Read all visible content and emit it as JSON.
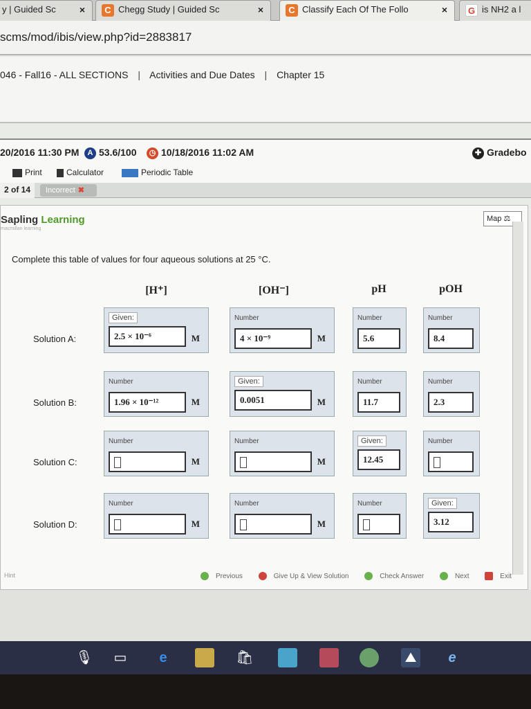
{
  "tabs": [
    {
      "label": "y | Guided Sc",
      "close": "×",
      "icon": "none"
    },
    {
      "label": "Chegg Study | Guided Sc",
      "close": "×",
      "icon": "C"
    },
    {
      "label": "Classify Each Of The Follo",
      "close": "×",
      "icon": "C"
    },
    {
      "label": "is NH2 a l",
      "close": "",
      "icon": "G"
    }
  ],
  "colors": {
    "chegg": "#e8772e",
    "google": "#d44638",
    "sapling_green": "#4f9a2a"
  },
  "url": "scms/mod/ibis/view.php?id=2883817",
  "breadcrumbs": {
    "course": "046 - Fall16 - ALL SECTIONS",
    "sep1": "|",
    "activities": "Activities and Due Dates",
    "sep2": "|",
    "chapter": "Chapter 15"
  },
  "status": {
    "due": "20/2016 11:30 PM",
    "score": "53.6/100",
    "date": "10/18/2016 11:02 AM",
    "gradebook": "Gradebo"
  },
  "toolbar": {
    "print": "Print",
    "calculator": "Calculator",
    "periodic": "Periodic Table"
  },
  "question": {
    "count": "2 of 14",
    "status": "Incorrect",
    "x": "✖"
  },
  "brand": {
    "part1": "Sapling",
    "part2": "Learning",
    "tagline": "macmillan learning",
    "map": "Map"
  },
  "prompt": "Complete this table of values for four aqueous solutions at 25 °C.",
  "columns": {
    "h": "[H⁺]",
    "oh": "[OH⁻]",
    "ph": "pH",
    "poh": "pOH"
  },
  "unit": "M",
  "solutions": [
    {
      "label": "Solution A:",
      "h_tag": "Given:",
      "h": "2.5 × 10⁻⁶",
      "oh_tag": "Number",
      "oh": "4 × 10⁻⁹",
      "ph_tag": "Number",
      "ph": "5.6",
      "poh_tag": "Number",
      "poh": "8.4"
    },
    {
      "label": "Solution B:",
      "h_tag": "Number",
      "h": "1.96 × 10⁻¹²",
      "oh_tag": "Given:",
      "oh": "0.0051",
      "ph_tag": "Number",
      "ph": "11.7",
      "poh_tag": "Number",
      "poh": "2.3"
    },
    {
      "label": "Solution C:",
      "h_tag": "Number",
      "h": "",
      "oh_tag": "Number",
      "oh": "",
      "ph_tag": "Given:",
      "ph": "12.45",
      "poh_tag": "Number",
      "poh": ""
    },
    {
      "label": "Solution D:",
      "h_tag": "Number",
      "h": "",
      "oh_tag": "Number",
      "oh": "",
      "ph_tag": "Number",
      "ph": "",
      "poh_tag": "Given:",
      "poh": "3.12"
    }
  ],
  "actions": {
    "previous": "Previous",
    "giveup": "Give Up & View Solution",
    "check": "Check Answer",
    "next": "Next",
    "exit": "Exit"
  },
  "hint_label": "Hint"
}
